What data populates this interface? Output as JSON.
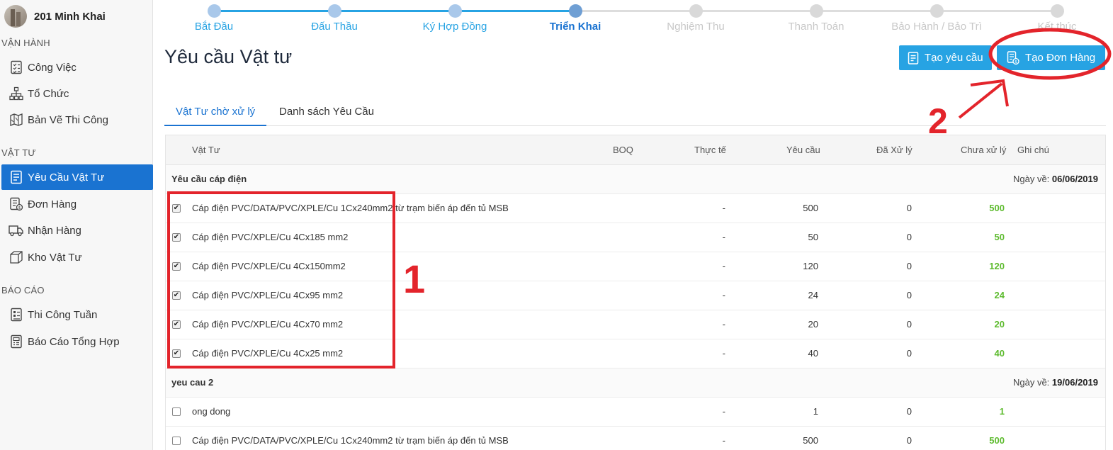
{
  "sidebar": {
    "project_name": "201 Minh Khai",
    "sections": [
      {
        "title": "VẬN HÀNH",
        "items": [
          {
            "label": "Công Việc",
            "icon": "checklist-icon"
          },
          {
            "label": "Tổ Chức",
            "icon": "org-chart-icon"
          },
          {
            "label": "Bản Vẽ Thi Công",
            "icon": "blueprint-icon"
          }
        ]
      },
      {
        "title": "VẬT TƯ",
        "items": [
          {
            "label": "Yêu Cầu Vật Tư",
            "icon": "request-doc-icon",
            "active": true
          },
          {
            "label": "Đơn Hàng",
            "icon": "order-doc-icon"
          },
          {
            "label": "Nhận Hàng",
            "icon": "truck-icon"
          },
          {
            "label": "Kho Vật Tư",
            "icon": "box-icon"
          }
        ]
      },
      {
        "title": "BÁO CÁO",
        "items": [
          {
            "label": "Thi Công Tuần",
            "icon": "report-icon"
          },
          {
            "label": "Báo Cáo Tổng Hợp",
            "icon": "report-summary-icon"
          }
        ]
      }
    ]
  },
  "stepper": {
    "steps": [
      {
        "label": "Bắt Đầu",
        "state": "done"
      },
      {
        "label": "Đấu Thầu",
        "state": "done"
      },
      {
        "label": "Ký Hợp Đồng",
        "state": "done"
      },
      {
        "label": "Triển Khai",
        "state": "current"
      },
      {
        "label": "Nghiệm Thu",
        "state": "todo"
      },
      {
        "label": "Thanh Toán",
        "state": "todo"
      },
      {
        "label": "Bảo Hành / Bảo Trì",
        "state": "todo"
      },
      {
        "label": "Kết thúc",
        "state": "todo"
      }
    ],
    "colors": {
      "done": "#a9c8ea",
      "current": "#6f9fd4",
      "todo": "#d9d9d9",
      "line_done": "#27a3e3",
      "line_todo": "#dddddd",
      "label_done": "#27a3e3",
      "label_current": "#1a73d1",
      "label_todo": "#c8c8c8"
    }
  },
  "header": {
    "title": "Yêu cầu Vật tư",
    "btn_create_request": "Tạo yêu cầu",
    "btn_create_order": "Tạo Đơn Hàng"
  },
  "tabs": [
    {
      "label": "Vật Tư chờ xử lý",
      "active": true
    },
    {
      "label": "Danh sách Yêu Cầu",
      "active": false
    }
  ],
  "table": {
    "columns": {
      "material": "Vật Tư",
      "boq": "BOQ",
      "actual": "Thực tế",
      "requested": "Yêu cầu",
      "processed": "Đã Xử lý",
      "pending": "Chưa xử lý",
      "note": "Ghi chú"
    },
    "date_label": "Ngày về:",
    "groups": [
      {
        "name": "Yêu cầu cáp điện",
        "date": "06/06/2019",
        "rows": [
          {
            "checked": true,
            "material": "Cáp điện PVC/DATA/PVC/XPLE/Cu 1Cx240mm2 từ trạm biến áp đến tủ MSB",
            "boq": "",
            "actual": "-",
            "requested": "500",
            "processed": "0",
            "pending": "500",
            "note": ""
          },
          {
            "checked": true,
            "material": "Cáp điện PVC/XPLE/Cu 4Cx185 mm2",
            "boq": "",
            "actual": "-",
            "requested": "50",
            "processed": "0",
            "pending": "50",
            "note": ""
          },
          {
            "checked": true,
            "material": "Cáp điện PVC/XPLE/Cu 4Cx150mm2",
            "boq": "",
            "actual": "-",
            "requested": "120",
            "processed": "0",
            "pending": "120",
            "note": ""
          },
          {
            "checked": true,
            "material": "Cáp điện PVC/XPLE/Cu 4Cx95 mm2",
            "boq": "",
            "actual": "-",
            "requested": "24",
            "processed": "0",
            "pending": "24",
            "note": ""
          },
          {
            "checked": true,
            "material": "Cáp điện PVC/XPLE/Cu 4Cx70 mm2",
            "boq": "",
            "actual": "-",
            "requested": "20",
            "processed": "0",
            "pending": "20",
            "note": ""
          },
          {
            "checked": true,
            "material": "Cáp điện PVC/XPLE/Cu 4Cx25 mm2",
            "boq": "",
            "actual": "-",
            "requested": "40",
            "processed": "0",
            "pending": "40",
            "note": ""
          }
        ]
      },
      {
        "name": "yeu cau 2",
        "date": "19/06/2019",
        "rows": [
          {
            "checked": false,
            "material": "ong dong",
            "boq": "",
            "actual": "-",
            "requested": "1",
            "processed": "0",
            "pending": "1",
            "note": ""
          },
          {
            "checked": false,
            "material": "Cáp điện PVC/DATA/PVC/XPLE/Cu 1Cx240mm2 từ trạm biến áp đến tủ MSB",
            "boq": "",
            "actual": "-",
            "requested": "500",
            "processed": "0",
            "pending": "500",
            "note": ""
          }
        ]
      }
    ]
  },
  "annotations": {
    "step1": "1",
    "step2": "2",
    "color": "#e3242b"
  }
}
